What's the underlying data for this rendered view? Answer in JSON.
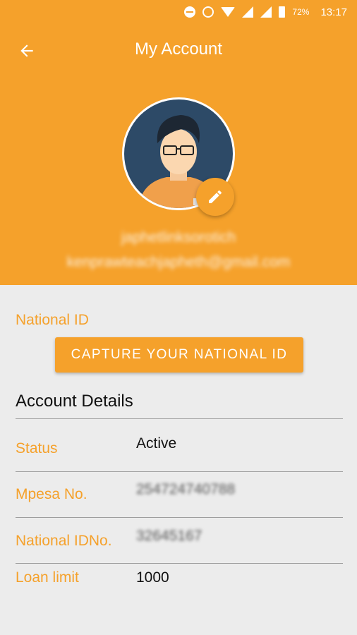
{
  "status_bar": {
    "battery_pct": "72%",
    "time": "13:17"
  },
  "toolbar": {
    "title": "My Account"
  },
  "profile": {
    "username": "japhetlinksorotich",
    "email": "kenprawteachjapheth@gmail.com"
  },
  "national_id_section": {
    "label": "National ID",
    "capture_button": "CAPTURE YOUR NATIONAL ID"
  },
  "account_details": {
    "title": "Account Details",
    "rows": [
      {
        "label": "Status",
        "value": "Active"
      },
      {
        "label": "Mpesa No.",
        "value": "254724740788"
      },
      {
        "label": "National IDNo.",
        "value": "32645167"
      },
      {
        "label": "Loan limit",
        "value": "1000"
      }
    ]
  },
  "colors": {
    "accent": "#f5a12b",
    "background": "#ececec",
    "avatar_bg": "#2d4a67"
  }
}
